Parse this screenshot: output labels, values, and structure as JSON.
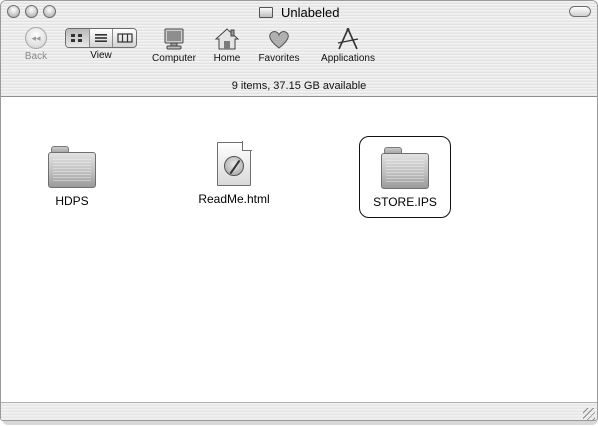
{
  "window": {
    "title": "Unlabeled",
    "icons": {
      "close": "close-button",
      "minimize": "minimize-button",
      "zoom": "zoom-button",
      "toolbar_toggle": "toolbar-toggle-button",
      "title_icon": "disk-icon"
    }
  },
  "toolbar": {
    "back": {
      "label": "Back",
      "icon": "back-arrow-icon",
      "enabled": false
    },
    "view": {
      "label": "View",
      "modes": [
        "icon",
        "list",
        "column"
      ],
      "active": "icon"
    },
    "computer": {
      "label": "Computer",
      "icon": "computer-icon"
    },
    "home": {
      "label": "Home",
      "icon": "home-icon"
    },
    "favorites": {
      "label": "Favorites",
      "icon": "heart-icon"
    },
    "applications": {
      "label": "Applications",
      "icon": "applications-icon"
    }
  },
  "status": {
    "text": "9 items, 37.15 GB available"
  },
  "items": [
    {
      "name": "HDPS",
      "type": "folder",
      "selected": false
    },
    {
      "name": "ReadMe.html",
      "type": "document",
      "selected": false
    },
    {
      "name": "STORE.IPS",
      "type": "folder",
      "selected": true
    }
  ]
}
